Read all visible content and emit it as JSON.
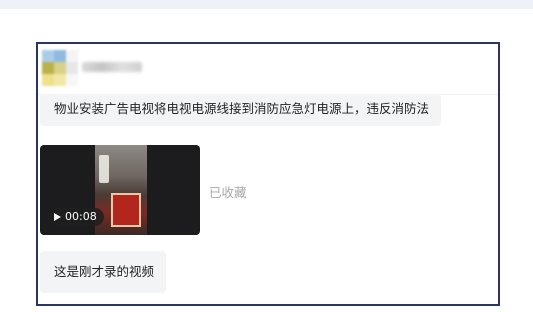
{
  "messages": {
    "text1": "物业安装广告电视将电视电源线接到消防应急灯电源上，违反消防法",
    "video": {
      "duration": "00:08",
      "play_icon": "play-icon",
      "status": "已收藏"
    },
    "text2": "这是刚才录的视频"
  },
  "colors": {
    "panel_border": "#2a3566",
    "bubble_bg": "#f3f4f6",
    "status_text": "#a8a8ad"
  }
}
